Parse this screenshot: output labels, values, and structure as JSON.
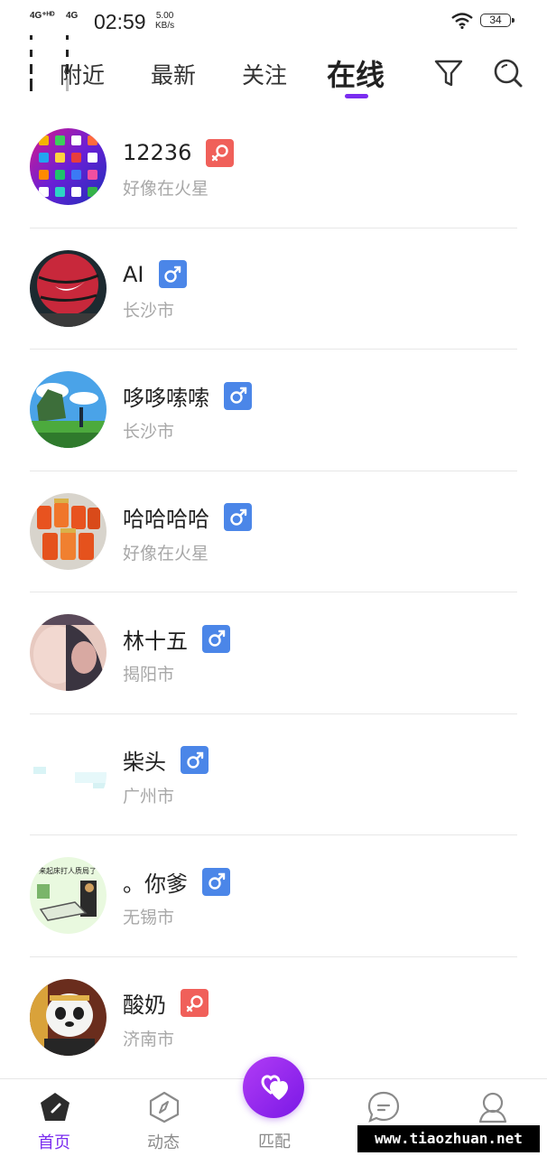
{
  "status_bar": {
    "network_1": "4G⁺ᴴᴰ",
    "network_2": "4G",
    "time": "02:59",
    "speed_value": "5.00",
    "speed_unit": "KB/s",
    "battery": "34"
  },
  "tabs": [
    {
      "label": "附近",
      "active": false
    },
    {
      "label": "最新",
      "active": false
    },
    {
      "label": "关注",
      "active": false
    },
    {
      "label": "在线",
      "active": true
    }
  ],
  "users": [
    {
      "name": "12236",
      "gender": "female",
      "location": "好像在火星",
      "avatar_icon": "phone-screen-avatar"
    },
    {
      "name": "AI",
      "gender": "male",
      "location": "长沙市",
      "avatar_icon": "basketball-avatar"
    },
    {
      "name": "哆哆嗦嗦",
      "gender": "male",
      "location": "长沙市",
      "avatar_icon": "landscape-avatar"
    },
    {
      "name": "哈哈哈哈",
      "gender": "male",
      "location": "好像在火星",
      "avatar_icon": "jars-avatar"
    },
    {
      "name": "林十五",
      "gender": "male",
      "location": "揭阳市",
      "avatar_icon": "photo-avatar"
    },
    {
      "name": "柴头",
      "gender": "male",
      "location": "广州市",
      "avatar_icon": "blank-avatar"
    },
    {
      "name": "。你爹",
      "gender": "male",
      "location": "无锡市",
      "avatar_icon": "meme-avatar"
    },
    {
      "name": "酸奶",
      "gender": "female",
      "location": "济南市",
      "avatar_icon": "panda-avatar"
    }
  ],
  "avatar_texts": {
    "meme": "来起床打人质局了"
  },
  "bottom_nav": {
    "home": "首页",
    "feed": "动态",
    "match": "匹配",
    "messages": "消息",
    "profile": "我的"
  },
  "colors": {
    "accent": "#7a2cf0",
    "male": "#4b86e8",
    "female": "#f0605a"
  },
  "watermark": "www.tiaozhuan.net"
}
